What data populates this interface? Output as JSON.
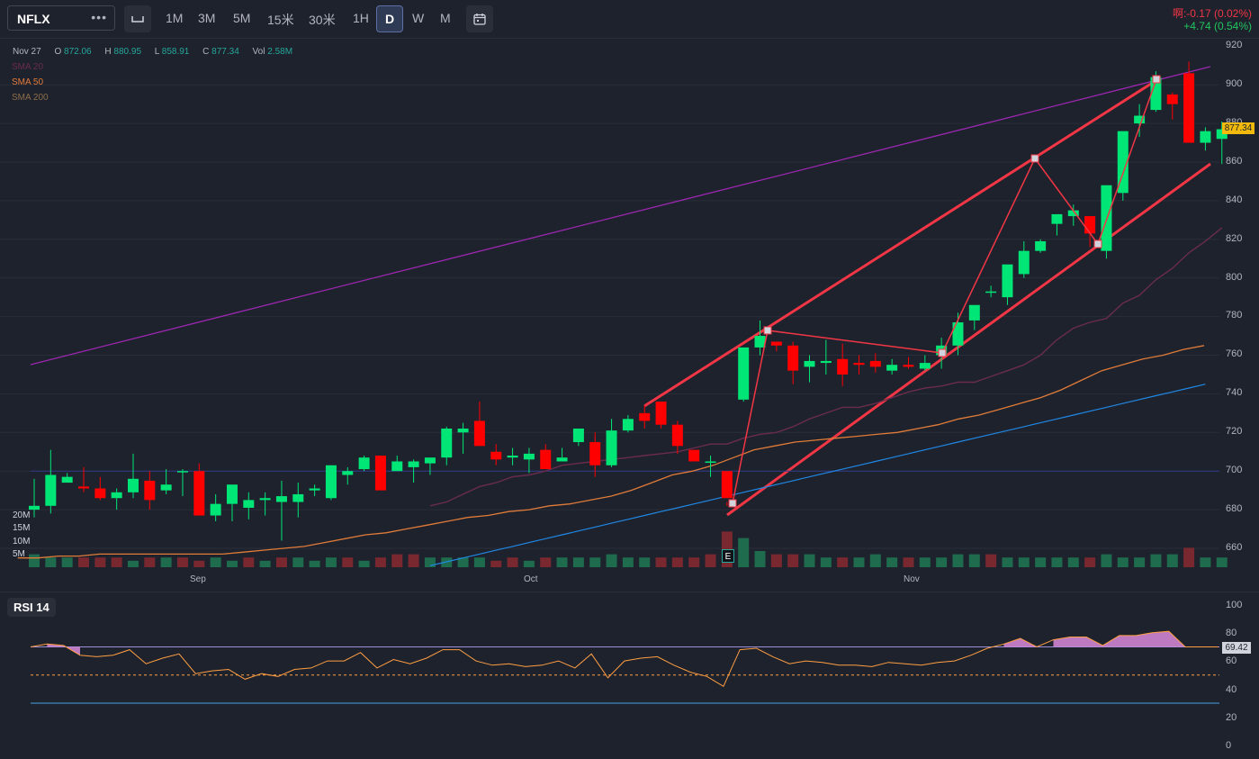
{
  "toolbar": {
    "symbol": "NFLX",
    "more": "•••",
    "timeframes": [
      {
        "label": "1M",
        "active": false
      },
      {
        "label": "3M",
        "active": false
      },
      {
        "label": "5M",
        "active": false
      },
      {
        "label": "15米",
        "active": false
      },
      {
        "label": "30米",
        "active": false
      },
      {
        "label": "1H",
        "active": false
      },
      {
        "label": "D",
        "active": true
      },
      {
        "label": "W",
        "active": false
      },
      {
        "label": "M",
        "active": false
      }
    ],
    "change_line1": "啊:-0.17 (0.02%)",
    "change_line2": "+4.74 (0.54%)"
  },
  "legend": {
    "date": "Nov 27",
    "o_label": "O",
    "o": "872.06",
    "h_label": "H",
    "h": "880.95",
    "l_label": "L",
    "l": "858.91",
    "c_label": "C",
    "c": "877.34",
    "vol_label": "Vol",
    "vol": "2.58M",
    "sma20": "SMA 20",
    "sma50": "SMA 50",
    "sma200": "SMA 200"
  },
  "colors": {
    "up": "#00e676",
    "down": "#ff0000",
    "sma20": "#6a2c4c",
    "sma50": "#e07b39",
    "sma200": "#1e88e5",
    "channel": "#f23645",
    "rsi": "#ff9f43"
  },
  "chart_data": {
    "type": "candlestick",
    "symbol": "NFLX",
    "interval": "D",
    "ylim": [
      650,
      920
    ],
    "y_ticks": [
      660,
      680,
      700,
      720,
      740,
      760,
      780,
      800,
      820,
      840,
      860,
      880,
      900,
      920
    ],
    "x_ticks": [
      {
        "label": "Sep",
        "index": 10
      },
      {
        "label": "Oct",
        "index": 30
      },
      {
        "label": "Nov",
        "index": 53
      }
    ],
    "last_price": "877.34",
    "volume_ticks": [
      "20M",
      "15M",
      "10M",
      "5M"
    ],
    "candles": [
      [
        680,
        696,
        676,
        682
      ],
      [
        682,
        711,
        678,
        698
      ],
      [
        694,
        699,
        694,
        697
      ],
      [
        692,
        702,
        689,
        691
      ],
      [
        691,
        697,
        685,
        686
      ],
      [
        686,
        691,
        680,
        689
      ],
      [
        689,
        709,
        686,
        696
      ],
      [
        695,
        700,
        680,
        685
      ],
      [
        690,
        701,
        688,
        693
      ],
      [
        700,
        701,
        687,
        700
      ],
      [
        700,
        704,
        677,
        677
      ],
      [
        677,
        688,
        674,
        683
      ],
      [
        683,
        687,
        674,
        693
      ],
      [
        681,
        689,
        675,
        685
      ],
      [
        685,
        689,
        677,
        686
      ],
      [
        684,
        695,
        664,
        687
      ],
      [
        684,
        694,
        676,
        688
      ],
      [
        690,
        693,
        687,
        691
      ],
      [
        686,
        702,
        685,
        703
      ],
      [
        698,
        702,
        693,
        700
      ],
      [
        701,
        708,
        700,
        707
      ],
      [
        708,
        708,
        696,
        690
      ],
      [
        700,
        708,
        702,
        705
      ],
      [
        702,
        706,
        694,
        705
      ],
      [
        704,
        705,
        698,
        707
      ],
      [
        707,
        723,
        703,
        722
      ],
      [
        720,
        725,
        709,
        722
      ],
      [
        726,
        736,
        713,
        713
      ],
      [
        710,
        714,
        703,
        706
      ],
      [
        707,
        712,
        703,
        708
      ],
      [
        706,
        712,
        699,
        709
      ],
      [
        711,
        714,
        705,
        701
      ],
      [
        705,
        712,
        707,
        707
      ],
      [
        715,
        721,
        713,
        722
      ],
      [
        715,
        720,
        697,
        703
      ],
      [
        703,
        727,
        702,
        721
      ],
      [
        721,
        729,
        720,
        727
      ],
      [
        730,
        734,
        722,
        726
      ],
      [
        736,
        736,
        722,
        724
      ],
      [
        724,
        726,
        709,
        713
      ],
      [
        711,
        709,
        707,
        705
      ],
      [
        705,
        708,
        697,
        705
      ],
      [
        700,
        684,
        682,
        686
      ],
      [
        737,
        764,
        736,
        764
      ],
      [
        764,
        778,
        760,
        770
      ],
      [
        767,
        767,
        762,
        765
      ],
      [
        765,
        767,
        745,
        752
      ],
      [
        754,
        760,
        746,
        757
      ],
      [
        756,
        768,
        750,
        757
      ],
      [
        758,
        766,
        744,
        750
      ],
      [
        756,
        760,
        750,
        755
      ],
      [
        757,
        761,
        751,
        754
      ],
      [
        752,
        758,
        750,
        755
      ],
      [
        755,
        759,
        753,
        754
      ],
      [
        753,
        760,
        752,
        756
      ],
      [
        760,
        769,
        753,
        765
      ],
      [
        765,
        782,
        760,
        777
      ],
      [
        778,
        785,
        773,
        786
      ],
      [
        793,
        796,
        790,
        793
      ],
      [
        790,
        805,
        786,
        807
      ],
      [
        802,
        819,
        800,
        814
      ],
      [
        814,
        820,
        813,
        819
      ],
      [
        828,
        831,
        822,
        833
      ],
      [
        832,
        838,
        827,
        835
      ],
      [
        832,
        832,
        816,
        823
      ],
      [
        814,
        848,
        810,
        848
      ],
      [
        844,
        876,
        840,
        876
      ],
      [
        880,
        890,
        873,
        884
      ],
      [
        887,
        907,
        886,
        904
      ],
      [
        895,
        896,
        882,
        890
      ],
      [
        906,
        912,
        870,
        870
      ],
      [
        870,
        878,
        866,
        876
      ],
      [
        872,
        881,
        859,
        877
      ]
    ],
    "volumes": [
      4,
      3,
      3,
      3,
      3,
      3,
      2,
      3,
      3,
      3,
      2,
      3,
      2,
      3,
      2,
      3,
      3,
      2,
      3,
      3,
      2,
      3,
      4,
      4,
      3,
      3,
      3,
      3,
      2,
      3,
      2,
      3,
      3,
      3,
      3,
      4,
      3,
      3,
      3,
      3,
      3,
      4,
      11,
      9,
      5,
      4,
      4,
      4,
      3,
      3,
      3,
      4,
      3,
      3,
      3,
      3,
      4,
      4,
      4,
      3,
      3,
      3,
      3,
      3,
      3,
      4,
      3,
      3,
      4,
      4,
      6,
      3,
      3
    ],
    "volume_up": [
      1,
      1,
      1,
      0,
      0,
      0,
      1,
      0,
      1,
      0,
      0,
      1,
      1,
      0,
      1,
      0,
      1,
      1,
      1,
      0,
      1,
      0,
      0,
      0,
      1,
      1,
      1,
      1,
      0,
      0,
      1,
      0,
      1,
      1,
      1,
      1,
      1,
      1,
      0,
      0,
      0,
      0,
      0,
      1,
      1,
      0,
      0,
      1,
      1,
      0,
      1,
      1,
      1,
      0,
      1,
      1,
      1,
      1,
      0,
      1,
      1,
      1,
      1,
      1,
      0,
      1,
      1,
      1,
      1,
      1,
      0,
      1,
      1
    ],
    "sma20": [
      null,
      null,
      null,
      null,
      null,
      null,
      null,
      null,
      null,
      null,
      null,
      null,
      null,
      null,
      null,
      null,
      null,
      null,
      null,
      null,
      682,
      684,
      688,
      692,
      694,
      697,
      698,
      700,
      703,
      704,
      705,
      706,
      707,
      708,
      709,
      710,
      712,
      714,
      714,
      717,
      719,
      720,
      723,
      727,
      730,
      733,
      733,
      735,
      738,
      741,
      743,
      744,
      746,
      746,
      749,
      752,
      755,
      760,
      768,
      774,
      777,
      779,
      787,
      791,
      799,
      805,
      813,
      819,
      826
    ],
    "sma50": [
      655,
      655,
      656,
      656,
      657,
      657,
      657,
      657,
      657,
      657,
      657,
      658,
      659,
      660,
      661,
      663,
      665,
      667,
      668,
      670,
      672,
      674,
      676,
      677,
      679,
      680,
      682,
      683,
      685,
      687,
      690,
      694,
      698,
      700,
      703,
      707,
      711,
      713,
      715,
      716,
      717,
      718,
      719,
      720,
      722,
      724,
      727,
      729,
      732,
      735,
      738,
      742,
      747,
      752,
      755,
      758,
      760,
      763,
      765
    ],
    "sma200": [
      null,
      null,
      null,
      null,
      null,
      null,
      null,
      null,
      null,
      null,
      null,
      null,
      null,
      null,
      null,
      null,
      null,
      null,
      null,
      null,
      null,
      null,
      651,
      653,
      655,
      657,
      659,
      661,
      663,
      665,
      667,
      669,
      671,
      673,
      675,
      677,
      679,
      681,
      683,
      685,
      687,
      689,
      691,
      693,
      695,
      697,
      699,
      701,
      703,
      705,
      707,
      709,
      711,
      713,
      715,
      717,
      719,
      721,
      723,
      725,
      727,
      729,
      731,
      733,
      735,
      737,
      739,
      741,
      743,
      745
    ],
    "rsi": {
      "label": "RSI 14",
      "ylim": [
        0,
        100
      ],
      "y_ticks": [
        0,
        20,
        40,
        60,
        80,
        100
      ],
      "overbought": 70,
      "oversold": 30,
      "mid": 50,
      "last": "69.42",
      "values": [
        70,
        72,
        71,
        64,
        63,
        64,
        68,
        58,
        62,
        65,
        51,
        53,
        54,
        47,
        51,
        49,
        54,
        55,
        60,
        60,
        66,
        55,
        61,
        58,
        62,
        68,
        68,
        60,
        57,
        58,
        56,
        57,
        60,
        55,
        65,
        48,
        60,
        62,
        63,
        57,
        52,
        49,
        42,
        68,
        69,
        63,
        58,
        60,
        59,
        57,
        57,
        56,
        59,
        58,
        57,
        59,
        60,
        64,
        69,
        72,
        76,
        70,
        75,
        77,
        77,
        71,
        78,
        78,
        80,
        81,
        70,
        70,
        70
      ]
    }
  }
}
